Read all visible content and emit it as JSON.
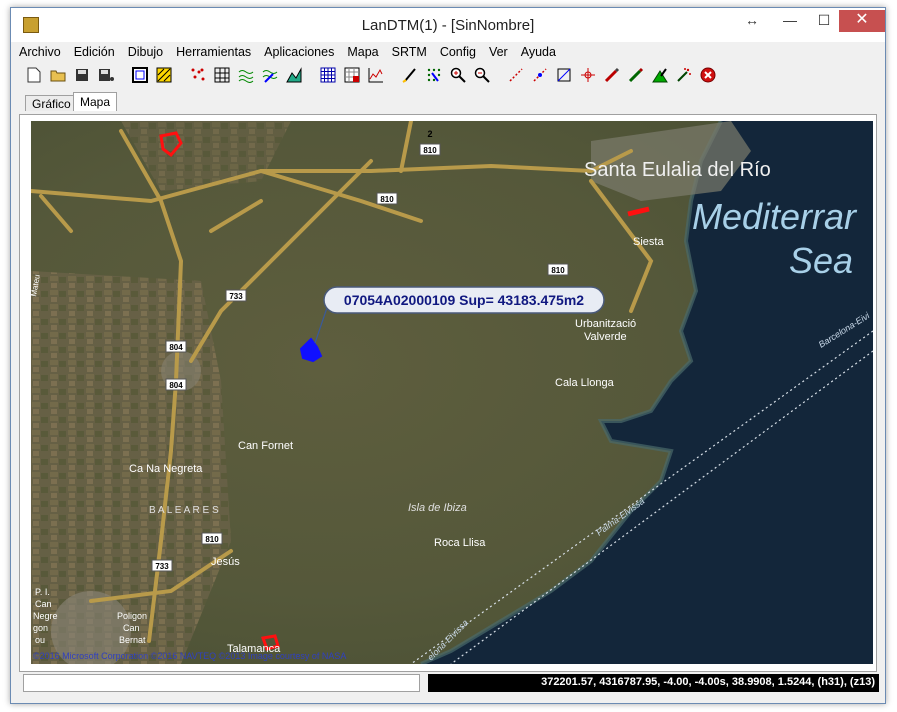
{
  "window": {
    "title": "LanDTM(1) - [SinNombre]",
    "controls": {
      "resize": "↔",
      "minimize": "—",
      "maximize": "☐",
      "close": "✕"
    }
  },
  "menu": [
    "Archivo",
    "Edición",
    "Dibujo",
    "Herramientas",
    "Aplicaciones",
    "Mapa",
    "SRTM",
    "Config",
    "Ver",
    "Ayuda"
  ],
  "tabs": [
    {
      "label": "Gráfico",
      "active": false
    },
    {
      "label": "Mapa",
      "active": true
    }
  ],
  "toolbar": [
    "new-file-icon",
    "open-folder-icon",
    "save-icon",
    "save-as-icon",
    "frame-icon",
    "hatch-icon",
    "points-icon",
    "edit-grid-icon",
    "contours-icon",
    "contours-edit-icon",
    "terrain-icon",
    "grid-icon",
    "grid-edit-icon",
    "profile-icon",
    "draw-pen-icon",
    "dots-grid-icon",
    "zoom-in-icon",
    "zoom-out-icon",
    "measure-icon",
    "measure-point-icon",
    "crop-icon",
    "target-icon",
    "pencil-icon",
    "brush-icon",
    "triangle-fill-icon",
    "magic-icon",
    "stop-icon"
  ],
  "map": {
    "labels": {
      "santa_eulalia": "Santa Eulalia del Río",
      "sea_1": "Mediterrar",
      "sea_2": "Sea",
      "siesta": "Siesta",
      "urbanitzacio": "Urbanització",
      "valverde": "Valverde",
      "cala_llonga": "Cala Llonga",
      "can_fornet": "Can Fornet",
      "ca_na_negreta": "Ca Na Negreta",
      "baleares": "B A L E A R E S",
      "isla_ibiza": "Isla de Ibiza",
      "roca_llisa": "Roca Llisa",
      "jesus": "Jesús",
      "talamanca": "Talamanca",
      "pi": "P. I.",
      "can_negre": "Can",
      "negre": "Negre",
      "gon": "gon",
      "nou": "ou",
      "poligon": "Poligon",
      "poligon_can": "Can",
      "bernat": "Bernat",
      "route_1": "Barcelona-Eivi",
      "route_2": "Palma-Eivissa",
      "route_3": "elona-Eivissa",
      "mateu": "Mateu",
      "copyright": "©2016 Microsoft Corporation  ©2016 NAVTEQ  ©2013 Image courtesy of NASA"
    },
    "roads": [
      "810",
      "810",
      "810",
      "733",
      "804",
      "804",
      "810",
      "733",
      "2"
    ],
    "callout": "07054A02000109  Sup= 43183.475m2"
  },
  "status": {
    "left": "",
    "coords": "372201.57, 4316787.95, -4.00, -4.00s, 38.9908, 1.5244, (h31), (z13)"
  },
  "colors": {
    "land": "#5a5c3c",
    "sea": "#13263a",
    "road": "#b89a4a",
    "highlight_blue": "#1010ff",
    "highlight_red": "#ff1010",
    "close_button": "#c75050"
  }
}
